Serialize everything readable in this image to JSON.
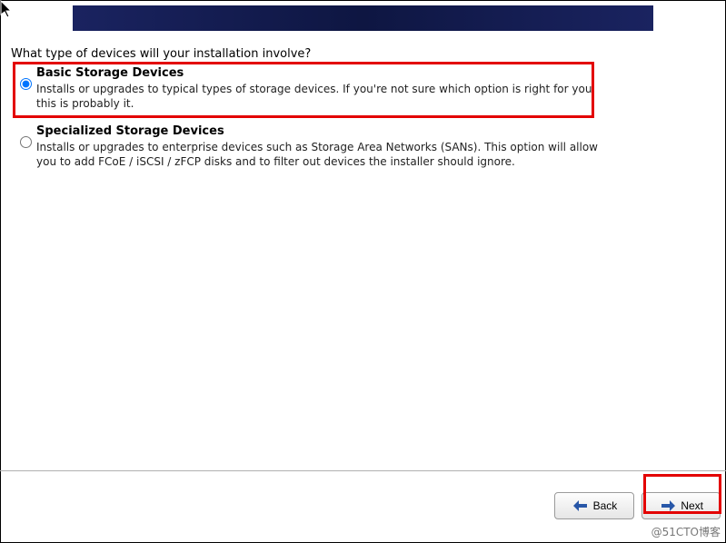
{
  "prompt": "What type of devices will your installation involve?",
  "options": [
    {
      "title": "Basic Storage Devices",
      "description": "Installs or upgrades to typical types of storage devices.  If you're not sure which option is right for you, this is probably it.",
      "selected": true
    },
    {
      "title": "Specialized Storage Devices",
      "description": "Installs or upgrades to enterprise devices such as Storage Area Networks (SANs). This option will allow you to add FCoE / iSCSI / zFCP disks and to filter out devices the installer should ignore.",
      "selected": false
    }
  ],
  "buttons": {
    "back": "Back",
    "next": "Next"
  },
  "watermark": "@51CTO博客"
}
